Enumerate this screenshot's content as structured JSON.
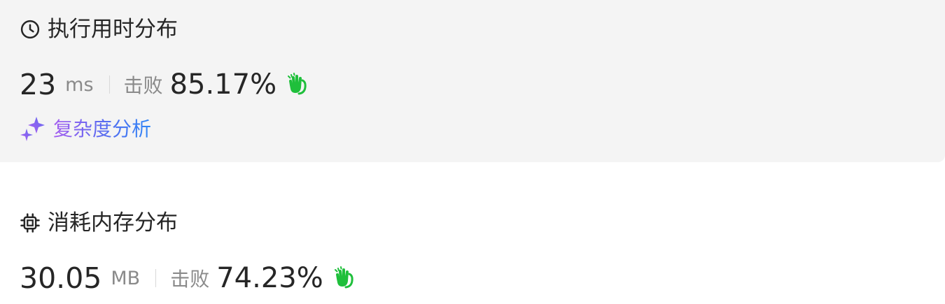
{
  "runtime": {
    "title": "执行用时分布",
    "value": "23",
    "unit": "ms",
    "beats_label": "击败",
    "beats_value": "85.17%",
    "icon": "clock-icon"
  },
  "analysis": {
    "label": "复杂度分析",
    "icon": "sparkle-icon"
  },
  "memory": {
    "title": "消耗内存分布",
    "value": "30.05",
    "unit": "MB",
    "beats_label": "击败",
    "beats_value": "74.23%",
    "icon": "chip-icon"
  },
  "colors": {
    "card_bg": "#f4f4f4",
    "text": "#262626",
    "muted": "#8a8a8a",
    "clap_green": "#1fbf3b",
    "analysis_gradient_start": "#a65ef0",
    "analysis_gradient_end": "#2f86f6"
  }
}
